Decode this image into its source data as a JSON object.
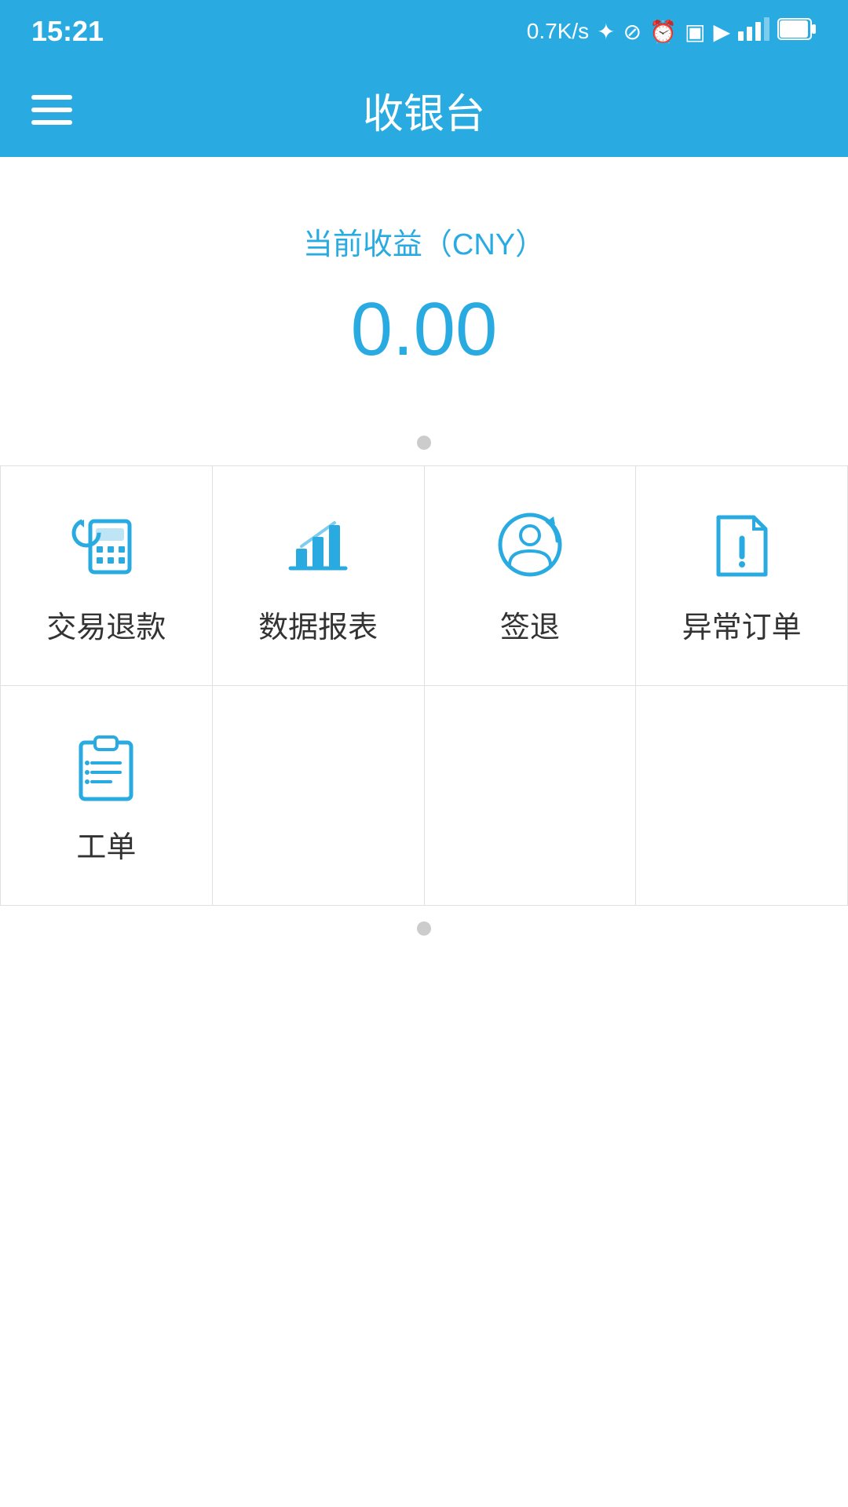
{
  "statusBar": {
    "time": "15:21",
    "networkSpeed": "0.7K/s",
    "icons": "0.7K/s ✦ ⊘ ⏰ ▣ ▶ ull 🔋"
  },
  "header": {
    "menuIcon": "≡",
    "title": "收银台"
  },
  "balance": {
    "label": "当前收益（CNY）",
    "amount": "0.00"
  },
  "gridItems": [
    {
      "id": "refund",
      "icon": "refund-icon",
      "label": "交易退款"
    },
    {
      "id": "report",
      "icon": "report-icon",
      "label": "数据报表"
    },
    {
      "id": "checkout",
      "icon": "checkout-icon",
      "label": "签退"
    },
    {
      "id": "abnormal",
      "icon": "abnormal-icon",
      "label": "异常订单"
    },
    {
      "id": "workorder",
      "icon": "workorder-icon",
      "label": "工单"
    }
  ]
}
